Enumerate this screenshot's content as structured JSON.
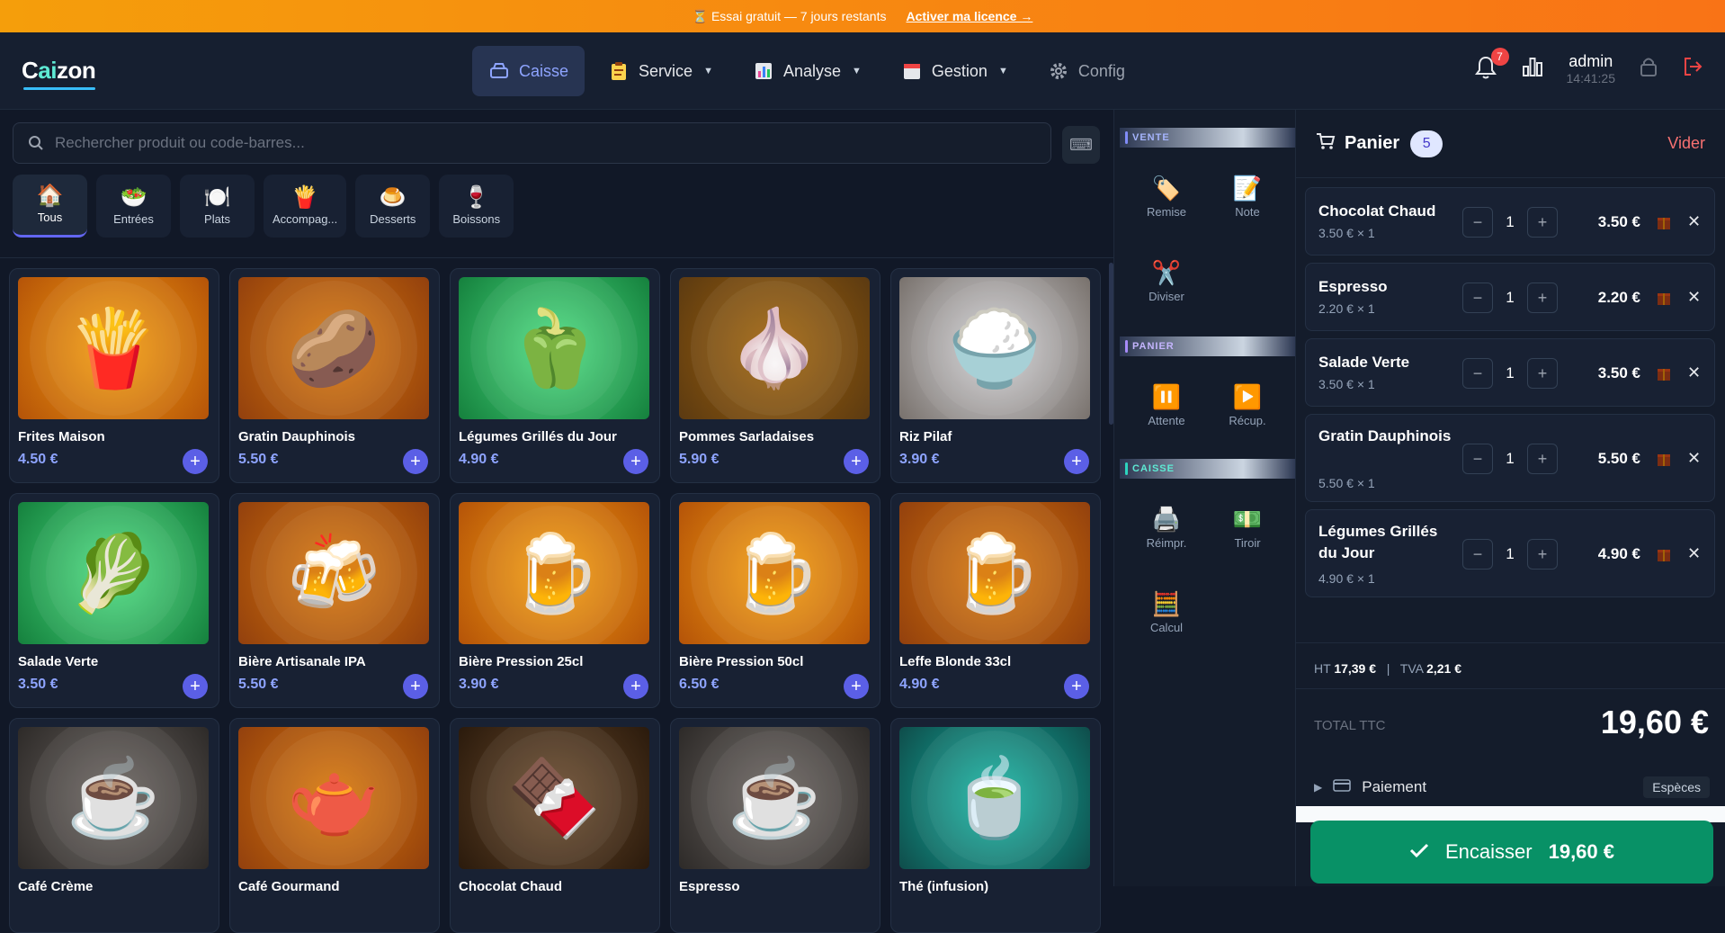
{
  "banner": {
    "text": "⏳ Essai gratuit — 7 jours restants",
    "link": "Activer ma licence →"
  },
  "header": {
    "logo": {
      "c": "C",
      "ai": "ai",
      "rest": "zon"
    },
    "nav": [
      {
        "label": "Caisse",
        "icon": "cash-register-icon"
      },
      {
        "label": "Service",
        "icon": "clipboard-icon"
      },
      {
        "label": "Analyse",
        "icon": "chart-icon"
      },
      {
        "label": "Gestion",
        "icon": "calendar-icon"
      },
      {
        "label": "Config",
        "icon": "gear-icon"
      }
    ],
    "notifications": "7",
    "user": {
      "name": "admin",
      "time": "14:41:25"
    }
  },
  "search": {
    "placeholder": "Rechercher produit ou code-barres..."
  },
  "categories": [
    {
      "label": "Tous",
      "emoji": "🏠"
    },
    {
      "label": "Entrées",
      "emoji": "🥗"
    },
    {
      "label": "Plats",
      "emoji": "🍽️"
    },
    {
      "label": "Accompag...",
      "emoji": "🍟"
    },
    {
      "label": "Desserts",
      "emoji": "🍮"
    },
    {
      "label": "Boissons",
      "emoji": "🍷"
    }
  ],
  "products": [
    {
      "name": "Frites Maison",
      "price": "4.50 €",
      "emoji": "🍟",
      "bg": "g-orange"
    },
    {
      "name": "Gratin Dauphinois",
      "price": "5.50 €",
      "emoji": "🥔",
      "bg": "g-orange2"
    },
    {
      "name": "Légumes Grillés du Jour",
      "price": "4.90 €",
      "emoji": "🫑",
      "bg": "g-green"
    },
    {
      "name": "Pommes Sarladaises",
      "price": "5.90 €",
      "emoji": "🧄",
      "bg": "g-brown"
    },
    {
      "name": "Riz Pilaf",
      "price": "3.90 €",
      "emoji": "🍚",
      "bg": "g-grey"
    },
    {
      "name": "Salade Verte",
      "price": "3.50 €",
      "emoji": "🥬",
      "bg": "g-green"
    },
    {
      "name": "Bière Artisanale IPA",
      "price": "5.50 €",
      "emoji": "🍻",
      "bg": "g-orange2"
    },
    {
      "name": "Bière Pression 25cl",
      "price": "3.90 €",
      "emoji": "🍺",
      "bg": "g-orange"
    },
    {
      "name": "Bière Pression 50cl",
      "price": "6.50 €",
      "emoji": "🍺",
      "bg": "g-orange"
    },
    {
      "name": "Leffe Blonde 33cl",
      "price": "4.90 €",
      "emoji": "🍺",
      "bg": "g-orange2"
    },
    {
      "name": "Café Crème",
      "price": "",
      "emoji": "☕",
      "bg": "g-greyb"
    },
    {
      "name": "Café Gourmand",
      "price": "",
      "emoji": "🫖",
      "bg": "g-orange2"
    },
    {
      "name": "Chocolat Chaud",
      "price": "",
      "emoji": "🍫",
      "bg": "g-dark"
    },
    {
      "name": "Espresso",
      "price": "",
      "emoji": "☕",
      "bg": "g-greyb"
    },
    {
      "name": "Thé (infusion)",
      "price": "",
      "emoji": "🍵",
      "bg": "g-teal"
    }
  ],
  "actions": {
    "vente": "VENTE",
    "panier": "PANIER",
    "caisse": "CAISSE",
    "remise": "Remise",
    "note": "Note",
    "diviser": "Diviser",
    "attente": "Attente",
    "recup": "Récup.",
    "reimpr": "Réimpr.",
    "tiroir": "Tiroir",
    "calcul": "Calcul"
  },
  "cart": {
    "title": "Panier",
    "count": "5",
    "clear": "Vider",
    "items": [
      {
        "name": "Chocolat Chaud",
        "unit": "3.50 € × 1",
        "qty": "1",
        "total": "3.50 €"
      },
      {
        "name": "Espresso",
        "unit": "2.20 € × 1",
        "qty": "1",
        "total": "2.20 €"
      },
      {
        "name": "Salade Verte",
        "unit": "3.50 € × 1",
        "qty": "1",
        "total": "3.50 €"
      },
      {
        "name": "Gratin Dauphinois",
        "unit": "5.50 € × 1",
        "qty": "1",
        "total": "5.50 €"
      },
      {
        "name": "Légumes Grillés du Jour",
        "unit": "4.90 € × 1",
        "qty": "1",
        "total": "4.90 €"
      }
    ],
    "ht_label": "HT",
    "ht": "17,39 €",
    "sep": "|",
    "tva_label": "TVA",
    "tva": "2,21 €",
    "total_label": "TOTAL TTC",
    "total": "19,60 €",
    "payment_label": "Paiement",
    "payment_method": "Espèces",
    "checkout_label": "Encaisser",
    "checkout_amount": "19,60 €"
  },
  "colors": {
    "accent": "#6366f1",
    "checkout": "#089166",
    "danger": "#f87171",
    "banner": "#f97316"
  }
}
